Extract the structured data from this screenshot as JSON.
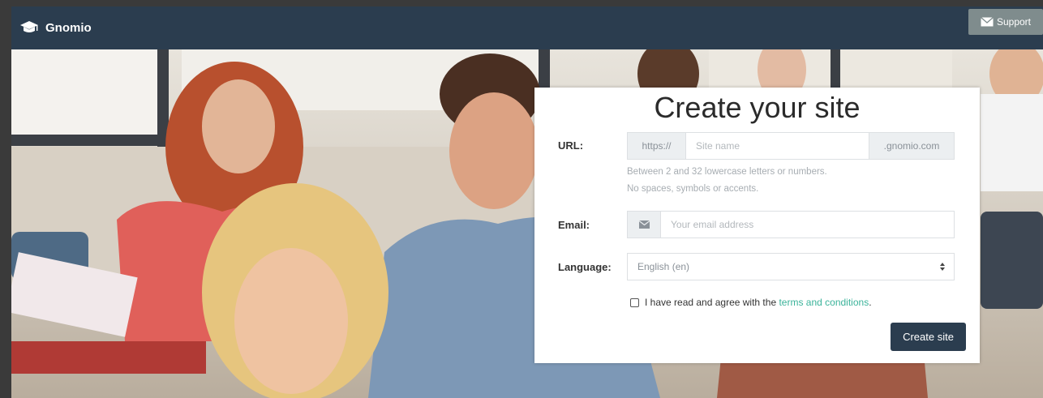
{
  "navbar": {
    "brand": "Gnomio",
    "support_label": "Support"
  },
  "form": {
    "title": "Create your site",
    "url": {
      "label": "URL:",
      "prefix": "https://",
      "placeholder": "Site name",
      "suffix": ".gnomio.com",
      "help_line1": "Between 2 and 32 lowercase letters or numbers.",
      "help_line2": "No spaces, symbols or accents."
    },
    "email": {
      "label": "Email:",
      "placeholder": "Your email address"
    },
    "language": {
      "label": "Language:",
      "selected": "English (en)"
    },
    "agree": {
      "text": "I have read and agree with the",
      "link": "terms and conditions",
      "end": "."
    },
    "submit_label": "Create site"
  },
  "colors": {
    "navbar": "#2b3d4f",
    "accent_link": "#3bb39a",
    "support_button": "#7f8c8d"
  }
}
